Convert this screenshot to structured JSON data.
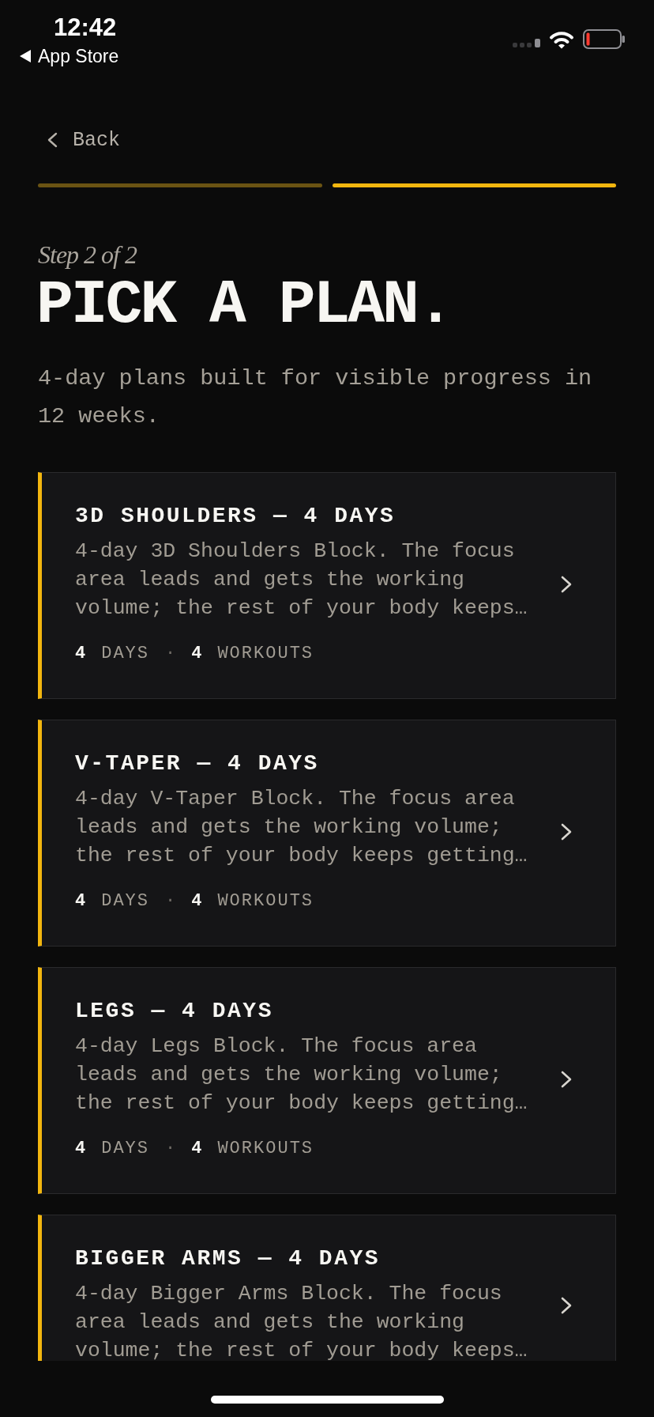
{
  "status_bar": {
    "time": "12:42",
    "return_app": "App Store"
  },
  "back_button": {
    "label": "Back"
  },
  "progress": {
    "segments": [
      {
        "current": false
      },
      {
        "current": true
      }
    ]
  },
  "step_label": "Step 2 of 2",
  "title": "PICK A PLAN.",
  "subtitle": "4-day plans built for visible progress in 12 weeks.",
  "plans": [
    {
      "title": "3D SHOULDERS — 4 DAYS",
      "description": "4-day 3D Shoulders Block. The focus area leads and gets the working volume; the rest of your body keeps…",
      "stats": [
        {
          "count": "4",
          "unit": "DAYS"
        },
        {
          "count": "4",
          "unit": "WORKOUTS"
        }
      ],
      "separator": "·"
    },
    {
      "title": "V-TAPER — 4 DAYS",
      "description": "4-day V-Taper Block. The focus area leads and gets the working volume; the rest of your body keeps getting…",
      "stats": [
        {
          "count": "4",
          "unit": "DAYS"
        },
        {
          "count": "4",
          "unit": "WORKOUTS"
        }
      ],
      "separator": "·"
    },
    {
      "title": "LEGS — 4 DAYS",
      "description": "4-day Legs Block. The focus area leads and gets the working volume; the rest of your body keeps getting…",
      "stats": [
        {
          "count": "4",
          "unit": "DAYS"
        },
        {
          "count": "4",
          "unit": "WORKOUTS"
        }
      ],
      "separator": "·"
    },
    {
      "title": "BIGGER ARMS — 4 DAYS",
      "description": "4-day Bigger Arms Block. The focus area leads and gets the working volume; the rest of your body keeps…"
    }
  ]
}
